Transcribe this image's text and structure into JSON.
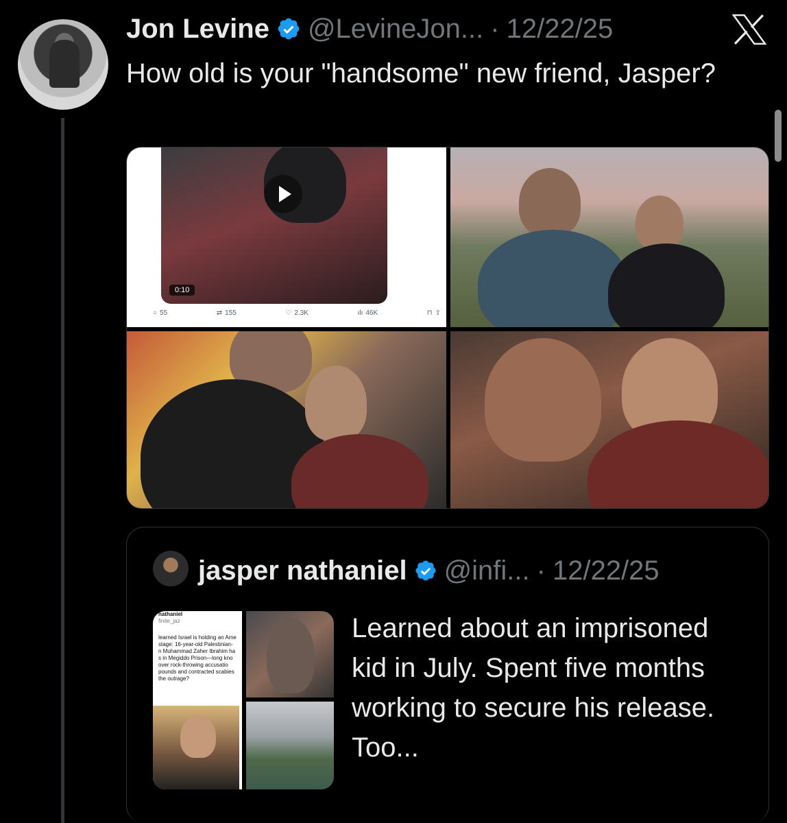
{
  "tweet": {
    "author_name": "Jon Levine",
    "author_handle": "@LevineJon...",
    "separator": "·",
    "date": "12/22/25",
    "text": "How old is your \"handsome\" new friend, Jasper?",
    "media": {
      "embedded_tweet": {
        "video_duration": "0:10",
        "replies": "55",
        "retweets": "155",
        "likes": "2.3K",
        "views": "46K"
      }
    }
  },
  "quoted_tweet": {
    "author_name": "jasper nathaniel",
    "author_handle": "@infi...",
    "separator": "·",
    "date": "12/22/25",
    "text": "Learned about an imprisoned kid in July. Spent five months working to secure his release. Too...",
    "screenshot_lines": [
      "nathaniel",
      "finite_jaz",
      "learned Israel is holding an Ame",
      "stage: 16-year-old Palestinian-",
      "n Muhammad Zaher Ibrahim ha",
      "s in Megiddo Prison—long kno",
      "over rock-throwing accusatio",
      "pounds and contracted scabies",
      "the outrage?"
    ]
  },
  "icons": {
    "verified": "verified-badge-icon",
    "platform": "x-logo-icon"
  },
  "colors": {
    "background": "#000000",
    "text": "#e7e9ea",
    "secondary_text": "#71767b",
    "verified_blue": "#1d9bf0",
    "border": "#2f3336"
  }
}
